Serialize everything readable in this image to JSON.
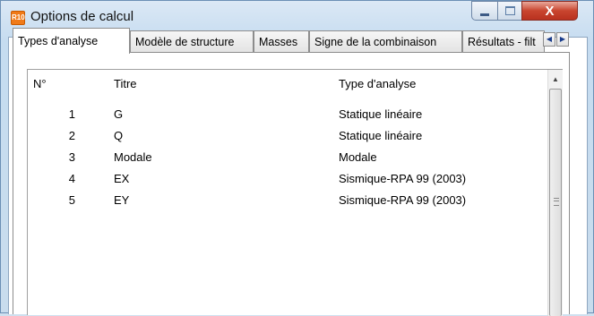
{
  "window": {
    "title": "Options de calcul",
    "app_icon": "R10",
    "controls": {
      "minimize": "minimize-icon",
      "maximize": "maximize-icon",
      "close": "X"
    }
  },
  "tabs": [
    {
      "label": "Types d'analyse",
      "active": true
    },
    {
      "label": "Modèle de structure",
      "active": false
    },
    {
      "label": "Masses",
      "active": false
    },
    {
      "label": "Signe de la combinaison",
      "active": false
    },
    {
      "label": "Résultats - filt",
      "active": false
    }
  ],
  "tab_scroll": {
    "left": "◀",
    "right": "▶"
  },
  "table": {
    "columns": {
      "n": "N°",
      "title": "Titre",
      "type": "Type d'analyse"
    },
    "rows": [
      {
        "n": "1",
        "title": "G",
        "type": "Statique linéaire"
      },
      {
        "n": "2",
        "title": "Q",
        "type": "Statique linéaire"
      },
      {
        "n": "3",
        "title": "Modale",
        "type": "Modale"
      },
      {
        "n": "4",
        "title": "EX",
        "type": "Sismique-RPA 99 (2003)"
      },
      {
        "n": "5",
        "title": "EY",
        "type": "Sismique-RPA 99 (2003)"
      }
    ]
  },
  "scrollbar": {
    "up": "▲"
  }
}
